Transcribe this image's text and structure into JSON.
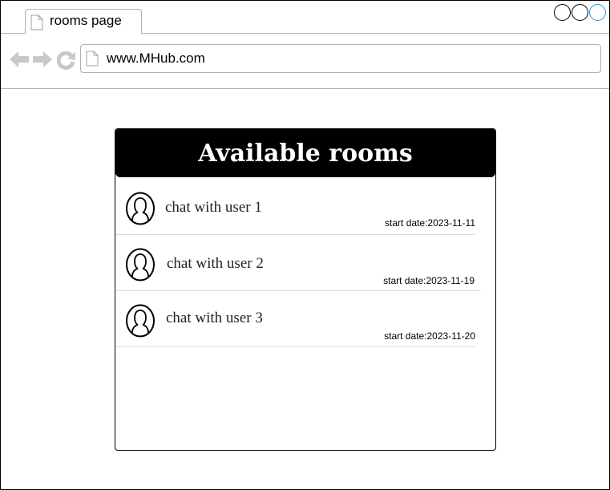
{
  "browser": {
    "tab_title": "rooms page",
    "address": "www.MHub.com",
    "icons": {
      "tab": "document-icon",
      "back": "back-arrow-icon",
      "forward": "forward-arrow-icon",
      "reload": "reload-icon",
      "address": "document-icon"
    },
    "window_controls": [
      "minimize-button",
      "restore-button",
      "maximize-button"
    ]
  },
  "rooms": {
    "title": "Available rooms",
    "date_label": "start date:",
    "items": [
      {
        "name": "chat with user 1",
        "start_date": "2023-11-11",
        "icon": "user-avatar-icon"
      },
      {
        "name": "chat with user 2",
        "start_date": "2023-11-19",
        "icon": "user-avatar-icon"
      },
      {
        "name": "chat with user 3",
        "start_date": "2023-11-20",
        "icon": "user-avatar-icon"
      }
    ]
  },
  "colors": {
    "header_background": "#000000",
    "header_text": "#ffffff",
    "maximize_accent": "#1ba1e2",
    "nav_icon": "#c8c8c8",
    "divider": "#dcdcdc"
  }
}
